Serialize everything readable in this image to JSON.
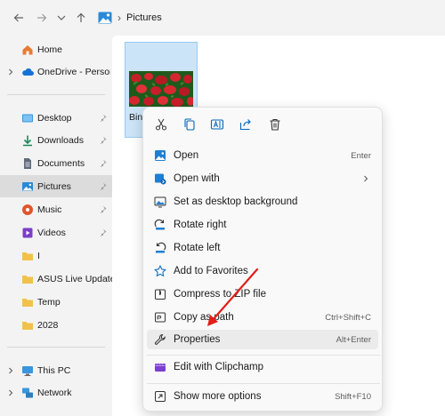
{
  "address": {
    "path": "Pictures"
  },
  "sidebar": {
    "items": [
      {
        "label": "Home"
      },
      {
        "label": "OneDrive - Persona"
      },
      {
        "label": "Desktop"
      },
      {
        "label": "Downloads"
      },
      {
        "label": "Documents"
      },
      {
        "label": "Pictures"
      },
      {
        "label": "Music"
      },
      {
        "label": "Videos"
      },
      {
        "label": "I"
      },
      {
        "label": "ASUS Live Update"
      },
      {
        "label": "Temp"
      },
      {
        "label": "2028"
      },
      {
        "label": "This PC"
      },
      {
        "label": "Network"
      }
    ]
  },
  "content": {
    "file_name": "Bing"
  },
  "context_menu": {
    "quick_actions": [
      "cut-icon",
      "copy-icon",
      "rename-icon",
      "share-icon",
      "delete-icon"
    ],
    "items": [
      {
        "label": "Open",
        "shortcut": "Enter"
      },
      {
        "label": "Open with",
        "shortcut": ""
      },
      {
        "label": "Set as desktop background",
        "shortcut": ""
      },
      {
        "label": "Rotate right",
        "shortcut": ""
      },
      {
        "label": "Rotate left",
        "shortcut": ""
      },
      {
        "label": "Add to Favorites",
        "shortcut": ""
      },
      {
        "label": "Compress to ZIP file",
        "shortcut": ""
      },
      {
        "label": "Copy as path",
        "shortcut": "Ctrl+Shift+C"
      },
      {
        "label": "Properties",
        "shortcut": "Alt+Enter"
      },
      {
        "label": "Edit with Clipchamp",
        "shortcut": ""
      },
      {
        "label": "Show more options",
        "shortcut": "Shift+F10"
      }
    ]
  },
  "colors": {
    "accent": "#0067c0",
    "selection": "#cce4f7",
    "annotation_arrow": "#e0201b",
    "folder": "#f2c14b"
  }
}
